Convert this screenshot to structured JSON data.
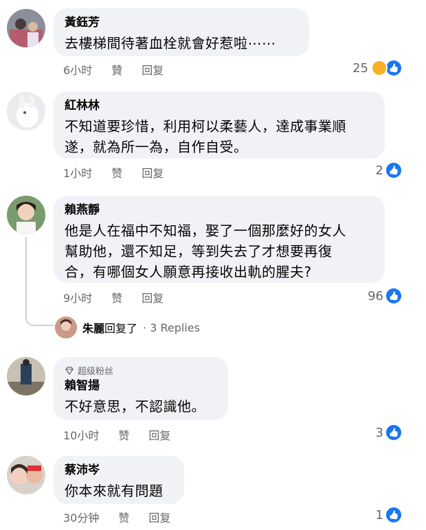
{
  "comments": [
    {
      "author": "黃鈺芳",
      "text": [
        "去樓梯間待著血栓就會好惹啦⋯⋯"
      ],
      "time": "6小时",
      "like_label": "贊",
      "reply_label": "回复",
      "reaction_count": "25",
      "reactions": [
        "haha-icon",
        "like-icon"
      ]
    },
    {
      "author": "紅林林",
      "text": [
        "不知道要珍惜，利用柯以柔藝人，達成事業順",
        "遂，就為所一為，自作自受。"
      ],
      "time": "1小时",
      "like_label": "赞",
      "reply_label": "回复",
      "reaction_count": "2",
      "reactions": [
        "like-icon"
      ]
    },
    {
      "author": "賴燕靜",
      "text": [
        "他是人在福中不知福，娶了一個那麼好的女人",
        "幫助他，還不知足，等到失去了才想要再復",
        "合，有哪個女人願意再接收出軌的腥夫?"
      ],
      "time": "9小时",
      "like_label": "赞",
      "reply_label": "回复",
      "reaction_count": "96",
      "reactions": [
        "like-icon"
      ],
      "replies": {
        "who": "朱麗",
        "action": "回复了",
        "count": "· 3 Replies"
      }
    },
    {
      "badge": "超级粉丝",
      "author": "賴智揚",
      "text": [
        "不好意思，不認識他。"
      ],
      "time": "10小时",
      "like_label": "赞",
      "reply_label": "回复",
      "reaction_count": "3",
      "reactions": [
        "like-icon"
      ]
    },
    {
      "author": "蔡沛岑",
      "text": [
        "你本來就有問題"
      ],
      "time": "30分钟",
      "like_label": "赞",
      "reply_label": "回复",
      "reaction_count": "1",
      "reactions": [
        "like-icon"
      ]
    }
  ],
  "colors": {
    "bubble": "#f0f2f5",
    "meta": "#65676b",
    "like": "#1877f2",
    "haha": "#f7b125"
  }
}
